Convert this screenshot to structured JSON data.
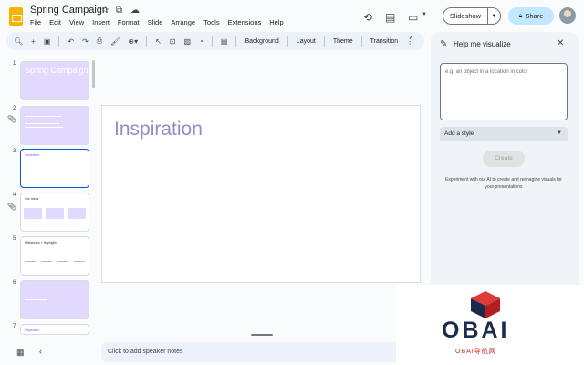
{
  "app": {
    "title": "Spring Campaign"
  },
  "menu": [
    "File",
    "Edit",
    "View",
    "Insert",
    "Format",
    "Slide",
    "Arrange",
    "Tools",
    "Extensions",
    "Help"
  ],
  "header": {
    "slideshow_label": "Slideshow",
    "share_label": "Share"
  },
  "toolbar": {
    "background_label": "Background",
    "layout_label": "Layout",
    "theme_label": "Theme",
    "transition_label": "Transition"
  },
  "filmstrip": [
    {
      "num": "1",
      "title": "Spring Campaign"
    },
    {
      "num": "2"
    },
    {
      "num": "3",
      "title": "Inspiration"
    },
    {
      "num": "4",
      "title": "Our Ideas"
    },
    {
      "num": "5",
      "title": "Milestones + Highlights"
    },
    {
      "num": "6"
    },
    {
      "num": "7",
      "title": "Inspiration"
    }
  ],
  "slide": {
    "title": "Inspiration"
  },
  "notes": {
    "placeholder": "Click to add speaker notes"
  },
  "panel": {
    "title": "Help me visualize",
    "prompt_placeholder": "e.g. an object in a location in color",
    "style_label": "Add a style",
    "create_label": "Create",
    "info_text": "Experiment with our AI to create and reimagine visuals for your presentations"
  },
  "watermark": {
    "brand": "OBAI",
    "sub": "OBAI导航网"
  },
  "colors": {
    "accent": "#0b57d0",
    "share_bg": "#c2e7ff",
    "slide_purple": "#e2d9ff",
    "title_purple": "#8e8ec6"
  },
  "icons": [
    "star-icon",
    "move-icon",
    "cloud-icon",
    "history-icon",
    "comment-icon",
    "video-icon",
    "search-icon",
    "zoom-icon",
    "close-icon",
    "pencil-sparkle-icon"
  ]
}
